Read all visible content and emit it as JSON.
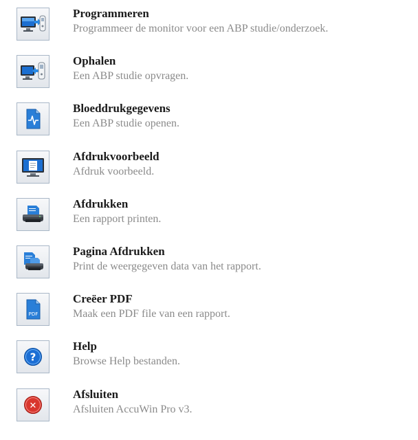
{
  "menu": {
    "items": [
      {
        "title": "Programmeren",
        "desc": "Programmeer de monitor voor een ABP studie/onderzoek.",
        "icon": "monitor-with-device-arrow-icon"
      },
      {
        "title": "Ophalen",
        "desc": "Een ABP studie opvragen.",
        "icon": "device-to-monitor-arrow-icon"
      },
      {
        "title": "Bloeddrukgegevens",
        "desc": "Een ABP studie openen.",
        "icon": "waveform-document-icon"
      },
      {
        "title": "Afdrukvoorbeeld",
        "desc": "Afdruk voorbeeld.",
        "icon": "print-preview-monitor-icon"
      },
      {
        "title": "Afdrukken",
        "desc": "Een rapport printen.",
        "icon": "printer-icon"
      },
      {
        "title": "Pagina Afdrukken",
        "desc": "Print de weergegeven data van het rapport.",
        "icon": "print-page-icon"
      },
      {
        "title": "Creëer PDF",
        "desc": "Maak een PDF file van een rapport.",
        "icon": "pdf-document-icon",
        "icon_text": "PDF"
      },
      {
        "title": "Help",
        "desc": "Browse Help bestanden.",
        "icon": "help-icon",
        "icon_text": "?"
      },
      {
        "title": "Afsluiten",
        "desc": "Afsluiten AccuWin Pro v3.",
        "icon": "close-icon",
        "icon_text": "✕"
      }
    ]
  },
  "colors": {
    "icon_blue": "#1c6fd1",
    "help_blue": "#1b6ed4",
    "close_red": "#d9362d",
    "border": "#a9b7c7",
    "desc_gray": "#8a8a8a"
  }
}
